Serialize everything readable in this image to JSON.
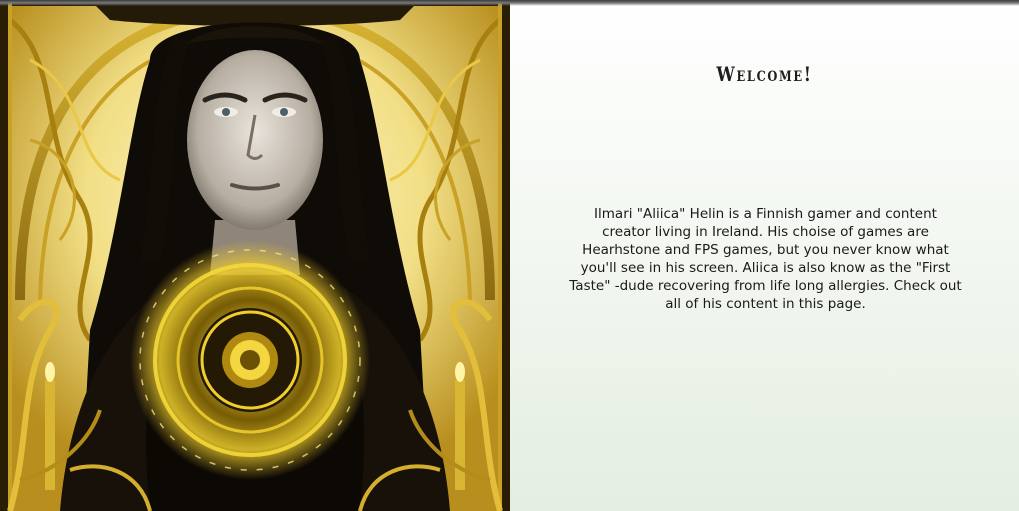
{
  "hero": {
    "image_alt": "Portrait artwork of a long-haired man in black robes with a glowing golden orb, framed by ornate gold art-nouveau decoration"
  },
  "main": {
    "heading": "Welcome!",
    "bio": "Ilmari \"Aliica\" Helin is a Finnish gamer and content creator living in Ireland. His choise of games are Hearhstone and FPS games, but you never know what you'll see in his screen. Aliica is also know as the \"First Taste\" -dude recovering from life long allergies. Check out all of his content in this page."
  },
  "colors": {
    "gold": "#e8c93a",
    "gold_light": "#f7eeb0",
    "dark": "#141008",
    "panel_top": "#ffffff",
    "panel_bottom": "#e4eee2"
  }
}
